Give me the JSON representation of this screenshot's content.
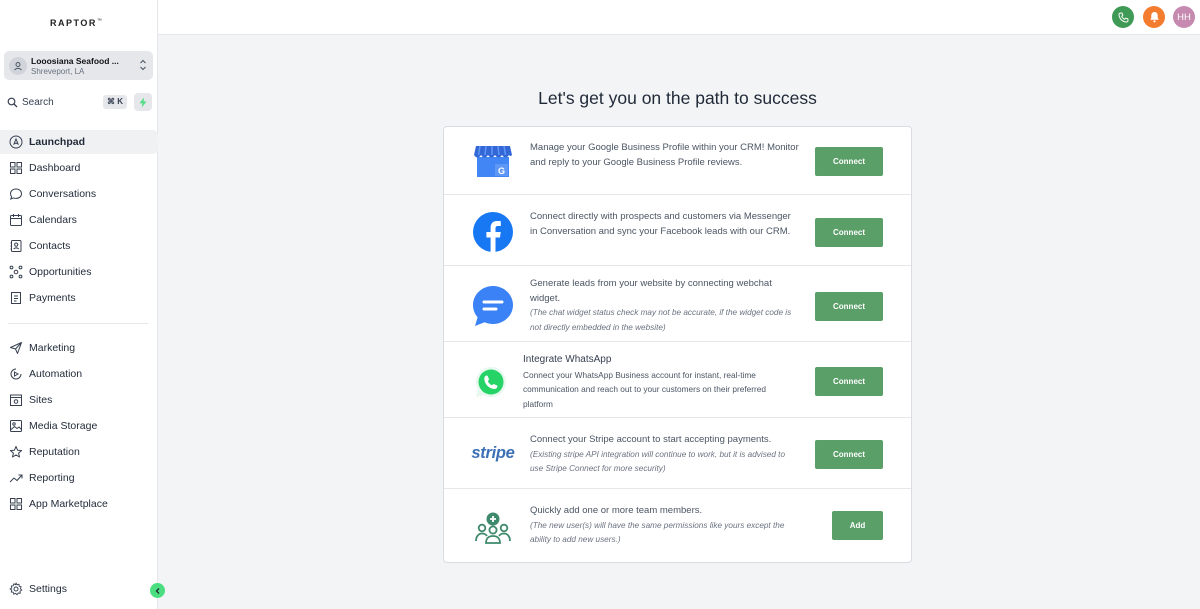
{
  "app": {
    "brand": "RAPTOR",
    "brand_tm": "™"
  },
  "location": {
    "name": "Looosiana Seafood ...",
    "city": "Shreveport, LA"
  },
  "search": {
    "label": "Search",
    "shortcut": "⌘ K"
  },
  "nav_primary": [
    {
      "label": "Launchpad",
      "icon": "rocket-icon",
      "active": true
    },
    {
      "label": "Dashboard",
      "icon": "grid-icon"
    },
    {
      "label": "Conversations",
      "icon": "chat-icon"
    },
    {
      "label": "Calendars",
      "icon": "calendar-icon"
    },
    {
      "label": "Contacts",
      "icon": "contacts-icon"
    },
    {
      "label": "Opportunities",
      "icon": "opportunities-icon"
    },
    {
      "label": "Payments",
      "icon": "payments-icon"
    }
  ],
  "nav_secondary": [
    {
      "label": "Marketing",
      "icon": "send-icon"
    },
    {
      "label": "Automation",
      "icon": "automation-icon"
    },
    {
      "label": "Sites",
      "icon": "sites-icon"
    },
    {
      "label": "Media Storage",
      "icon": "image-icon"
    },
    {
      "label": "Reputation",
      "icon": "star-icon"
    },
    {
      "label": "Reporting",
      "icon": "trend-icon"
    },
    {
      "label": "App Marketplace",
      "icon": "apps-icon"
    }
  ],
  "settings": {
    "label": "Settings"
  },
  "topbar": {
    "user_initials": "HH",
    "colors": {
      "phone": "#3f9a56",
      "bell": "#f47c2f",
      "avatar": "#c689b0"
    }
  },
  "main": {
    "heading": "Let's get you on the path to success",
    "rows": [
      {
        "id": "google",
        "icon": "google-business-icon",
        "text": "Manage your Google Business Profile within your CRM! Monitor and reply to your Google Business Profile reviews.",
        "button": "Connect"
      },
      {
        "id": "facebook",
        "icon": "facebook-icon",
        "text": "Connect directly with prospects and customers via Messenger in Conversation and sync your Facebook leads with our CRM.",
        "button": "Connect"
      },
      {
        "id": "webchat",
        "icon": "webchat-icon",
        "text": "Generate leads from your website by connecting webchat widget.",
        "note": "(The chat widget status check may not be accurate, if the widget code is not directly embedded in the website)",
        "button": "Connect"
      },
      {
        "id": "whatsapp",
        "icon": "whatsapp-icon",
        "title": "Integrate WhatsApp",
        "text": "Connect your WhatsApp Business account for instant, real-time communication and reach out to your customers on their preferred platform",
        "button": "Connect"
      },
      {
        "id": "stripe",
        "icon": "stripe-icon",
        "logo_text": "stripe",
        "text": "Connect your Stripe account to start accepting payments.",
        "note": "(Existing stripe API integration will continue to work, but it is advised to use Stripe Connect for more security)",
        "button": "Connect"
      },
      {
        "id": "team",
        "icon": "team-add-icon",
        "text": "Quickly add one or more team members.",
        "note": "(The new user(s) will have the same permissions like yours except the ability to add new users.)",
        "button": "Add"
      }
    ]
  },
  "colors": {
    "accent_button": "#5a9e68",
    "facebook": "#1877f2",
    "webchat": "#3b82f6",
    "whatsapp": "#25d366",
    "stripe": "#3b6fb6",
    "team": "#3f8a6c"
  }
}
